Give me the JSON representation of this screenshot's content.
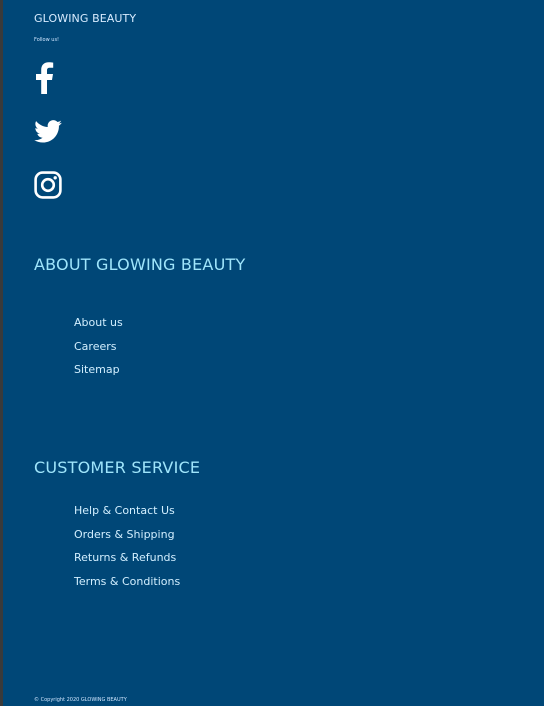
{
  "footer": {
    "brand": "GLOWING BEAUTY",
    "follow_label": "Follow us!",
    "social": [
      {
        "icon": "facebook-icon",
        "color": "#ffffff"
      },
      {
        "icon": "twitter-icon",
        "color": "#ffffff"
      },
      {
        "icon": "instagram-icon",
        "color": "#ffffff"
      }
    ],
    "about": {
      "title": "ABOUT GLOWING BEAUTY",
      "links": [
        {
          "label": "About us"
        },
        {
          "label": "Careers"
        },
        {
          "label": "Sitemap"
        }
      ]
    },
    "service": {
      "title": "CUSTOMER SERVICE",
      "links": [
        {
          "label": "Help & Contact Us"
        },
        {
          "label": "Orders & Shipping"
        },
        {
          "label": "Returns & Refunds"
        },
        {
          "label": "Terms & Conditions"
        }
      ]
    },
    "copyright": "© Copyright 2020 GLOWING BEAUTY"
  },
  "colors": {
    "background": "#004777",
    "heading": "#9fe5fb",
    "link": "#d2efff"
  }
}
